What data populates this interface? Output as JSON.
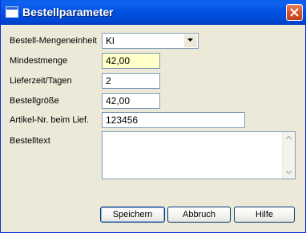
{
  "window": {
    "title": "Bestellparameter"
  },
  "form": {
    "unit": {
      "label": "Bestell-Mengeneinheit",
      "selected": "Kl"
    },
    "min_qty": {
      "label": "Mindestmenge",
      "value": "42,00"
    },
    "lead_time": {
      "label": "Lieferzeit/Tagen",
      "value": "2"
    },
    "order_size": {
      "label": "Bestellgröße",
      "value": "42,00"
    },
    "supplier_article": {
      "label": "Artikel-Nr. beim Lief.",
      "value": "123456"
    },
    "order_text": {
      "label": "Bestelltext",
      "value": ""
    }
  },
  "buttons": {
    "save": "Speichern",
    "cancel": "Abbruch",
    "help": "Hilfe"
  },
  "colors": {
    "titlebar": "#0054e3",
    "highlight_field": "#ffffc8",
    "close_button": "#d6532e"
  },
  "icons": {
    "window": "window-icon",
    "close": "close-icon",
    "dropdown": "chevron-down-icon",
    "scroll_up": "scroll-up-arrow-icon",
    "scroll_down": "scroll-down-arrow-icon"
  }
}
